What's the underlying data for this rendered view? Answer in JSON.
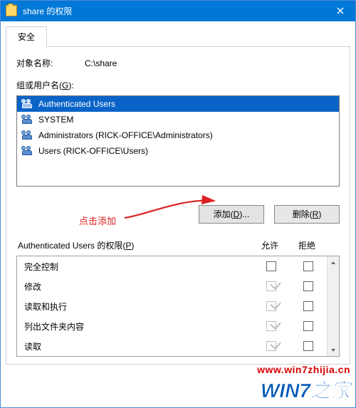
{
  "window": {
    "title": "share 的权限",
    "close_label": "Close"
  },
  "tabs": {
    "security": "安全"
  },
  "object": {
    "label": "对象名称:",
    "value": "C:\\share"
  },
  "groups": {
    "label_pre": "组或用户名(",
    "label_u": "G",
    "label_post": "):",
    "items": [
      {
        "name": "Authenticated Users",
        "selected": true
      },
      {
        "name": "SYSTEM",
        "selected": false
      },
      {
        "name": "Administrators (RICK-OFFICE\\Administrators)",
        "selected": false
      },
      {
        "name": "Users (RICK-OFFICE\\Users)",
        "selected": false
      }
    ]
  },
  "annotation": {
    "hint": "点击添加"
  },
  "buttons": {
    "add_pre": "添加(",
    "add_u": "D",
    "add_post": ")...",
    "remove_pre": "删除(",
    "remove_u": "R",
    "remove_post": ")"
  },
  "perm_header": {
    "title_pre": "Authenticated Users 的权限(",
    "title_u": "P",
    "title_post": ")",
    "allow": "允许",
    "deny": "拒绝"
  },
  "permissions": [
    {
      "name": "完全控制",
      "allow": false,
      "deny": false,
      "allow_disabled": false
    },
    {
      "name": "修改",
      "allow": true,
      "deny": false,
      "allow_disabled": true
    },
    {
      "name": "读取和执行",
      "allow": true,
      "deny": false,
      "allow_disabled": true
    },
    {
      "name": "列出文件夹内容",
      "allow": true,
      "deny": false,
      "allow_disabled": true
    },
    {
      "name": "读取",
      "allow": true,
      "deny": false,
      "allow_disabled": true
    }
  ],
  "watermark": {
    "url": "www.win7zhijia.cn",
    "logo": "WIN7之家"
  }
}
